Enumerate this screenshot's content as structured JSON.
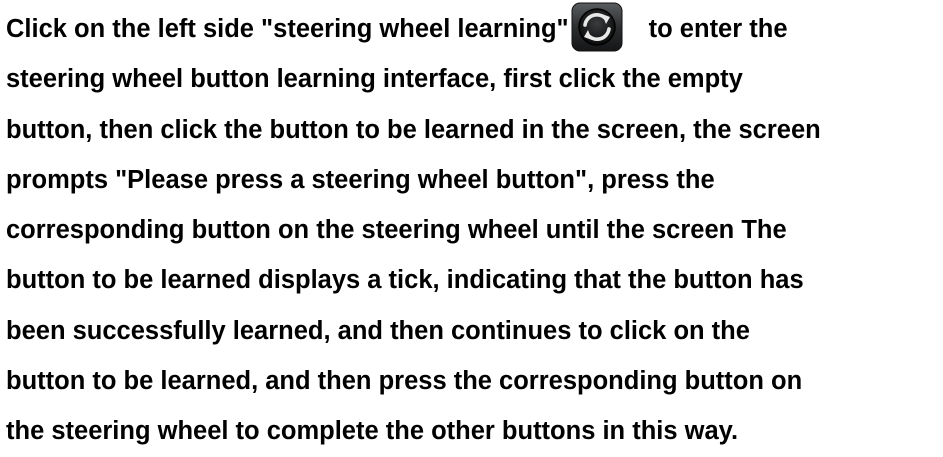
{
  "paragraph": {
    "line1_before_icon": "Click on the left side \"steering wheel learning\"",
    "line1_after_icon": "to enter the",
    "line2": "steering wheel button learning interface, first click the empty",
    "line3": "button, then click the button to be learned in the screen, the screen",
    "line4": "prompts \"Please press a steering wheel button\", press the",
    "line5": "corresponding button on the steering wheel until the screen The",
    "line6": "button to be learned displays a tick, indicating that the button has",
    "line7": "been successfully learned, and then continues to click on the",
    "line8": "button to be learned, and then press the corresponding button on",
    "line9": "the steering wheel to complete the other buttons in this way."
  },
  "icon": {
    "name": "refresh-icon",
    "background_color": "#2b2d2f",
    "ring_color": "#0a0a0a",
    "arrow_color": "#e8e8e8"
  },
  "colors": {
    "text": "#000000",
    "background": "#ffffff"
  }
}
